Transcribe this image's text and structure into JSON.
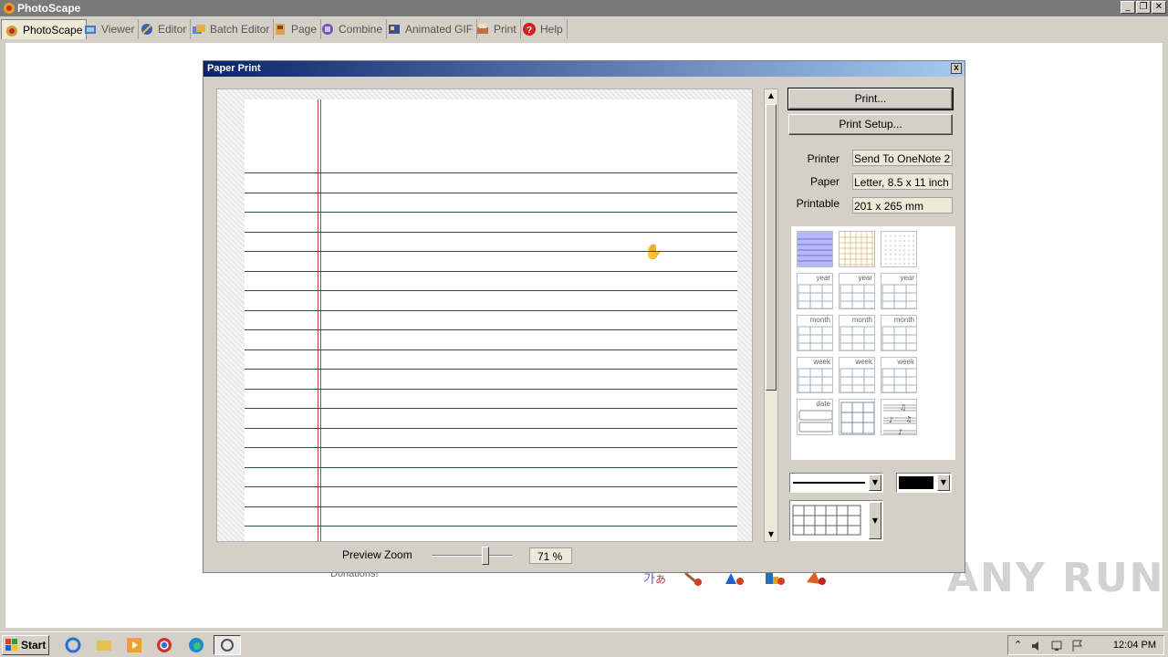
{
  "app": {
    "title": "PhotoScape"
  },
  "menu": [
    {
      "label": "PhotoScape",
      "icon": "photoscape-icon"
    },
    {
      "label": "Viewer",
      "icon": "viewer-icon"
    },
    {
      "label": "Editor",
      "icon": "editor-icon"
    },
    {
      "label": "Batch Editor",
      "icon": "batch-editor-icon"
    },
    {
      "label": "Page",
      "icon": "page-icon"
    },
    {
      "label": "Combine",
      "icon": "combine-icon"
    },
    {
      "label": "Animated GIF",
      "icon": "animated-gif-icon"
    },
    {
      "label": "Print",
      "icon": "print-icon"
    },
    {
      "label": "Help",
      "icon": "help-icon"
    }
  ],
  "workspace": {
    "donations_text": "Donations!"
  },
  "dialog": {
    "title": "Paper Print",
    "close_symbol": "x",
    "print_button": "Print...",
    "print_setup_button": "Print Setup...",
    "printer_label": "Printer",
    "printer_value": "Send To OneNote 2",
    "paper_label": "Paper",
    "paper_value": "Letter, 8.5 x 11 inch",
    "printable_label": "Printable",
    "printable_value": "201 x 265 mm",
    "preview_zoom_label": "Preview Zoom",
    "zoom_value": "71 %",
    "zoom_fraction": 0.68,
    "templates": [
      {
        "label": "",
        "kind": "lined-blue"
      },
      {
        "label": "",
        "kind": "grid-tan"
      },
      {
        "label": "",
        "kind": "dots"
      },
      {
        "label": "year",
        "kind": "calendar"
      },
      {
        "label": "year",
        "kind": "calendar"
      },
      {
        "label": "year",
        "kind": "calendar"
      },
      {
        "label": "month",
        "kind": "calendar"
      },
      {
        "label": "month",
        "kind": "calendar"
      },
      {
        "label": "month",
        "kind": "calendar"
      },
      {
        "label": "week",
        "kind": "calendar"
      },
      {
        "label": "week",
        "kind": "calendar"
      },
      {
        "label": "week",
        "kind": "calendar"
      },
      {
        "label": "date",
        "kind": "date"
      },
      {
        "label": "",
        "kind": "boxes"
      },
      {
        "label": "",
        "kind": "music"
      }
    ],
    "line_color": "#000000"
  },
  "watermark": "ANY RUN",
  "taskbar": {
    "start_label": "Start",
    "clock": "12:04 PM"
  }
}
